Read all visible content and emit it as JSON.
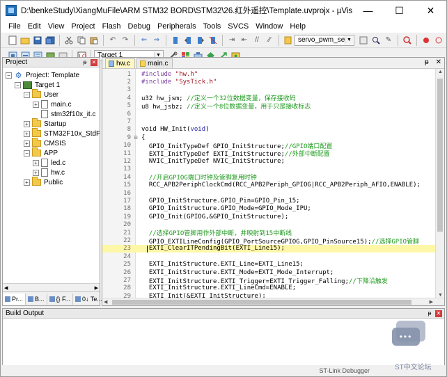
{
  "window": {
    "title": "D:\\benkeStudy\\XiangMuFile\\ARM STM32 BORD\\STM32\\26.红外遥控\\Template.uvprojx - µVision",
    "minimize_glyph": "—",
    "maximize_glyph": "☐",
    "close_glyph": "✕"
  },
  "menu": [
    "File",
    "Edit",
    "View",
    "Project",
    "Flash",
    "Debug",
    "Peripherals",
    "Tools",
    "SVCS",
    "Window",
    "Help"
  ],
  "toolbar1": {
    "target_combo": "servo_pwm_set"
  },
  "toolbar2": {
    "target_combo": "Target 1"
  },
  "project": {
    "title": "Project",
    "pin_glyph": "ᵽ",
    "close_glyph": "✕",
    "tree": [
      {
        "label": "Project: Template",
        "indent": 0,
        "icon": "project",
        "expander": "−"
      },
      {
        "label": "Target 1",
        "indent": 1,
        "icon": "target",
        "expander": "−"
      },
      {
        "label": "User",
        "indent": 2,
        "icon": "folder",
        "expander": "−"
      },
      {
        "label": "main.c",
        "indent": 3,
        "icon": "file",
        "expander": "+"
      },
      {
        "label": "stm32f10x_it.c",
        "indent": 3,
        "icon": "file",
        "expander": ""
      },
      {
        "label": "Startup",
        "indent": 2,
        "icon": "folder",
        "expander": "+"
      },
      {
        "label": "STM32F10x_StdPeriph",
        "indent": 2,
        "icon": "folder",
        "expander": "+"
      },
      {
        "label": "CMSIS",
        "indent": 2,
        "icon": "folder",
        "expander": "+"
      },
      {
        "label": "APP",
        "indent": 2,
        "icon": "folder",
        "expander": "−"
      },
      {
        "label": "led.c",
        "indent": 3,
        "icon": "file",
        "expander": "+"
      },
      {
        "label": "hw.c",
        "indent": 3,
        "icon": "file",
        "expander": "+"
      },
      {
        "label": "Public",
        "indent": 2,
        "icon": "folder",
        "expander": "+"
      }
    ],
    "tabs": [
      "Pr...",
      "B...",
      "{} F...",
      "0↓ Te..."
    ]
  },
  "editor": {
    "tabs": [
      {
        "label": "hw.c",
        "active": true
      },
      {
        "label": "main.c",
        "active": false
      }
    ],
    "pin_glyph": "ᵽ",
    "close_glyph": "✕",
    "current_line": 23,
    "lines": [
      {
        "n": "1",
        "fold": "",
        "parts": [
          {
            "t": "#include ",
            "c": "pp"
          },
          {
            "t": "\"hw.h\"",
            "c": "str"
          }
        ]
      },
      {
        "n": "2",
        "fold": "",
        "parts": [
          {
            "t": "#include ",
            "c": "pp"
          },
          {
            "t": "\"SysTick.h\"",
            "c": "str"
          }
        ]
      },
      {
        "n": "3",
        "fold": "",
        "parts": []
      },
      {
        "n": "4",
        "fold": "",
        "parts": [
          {
            "t": "u32 hw_jsm; ",
            "c": "txt"
          },
          {
            "t": "//定义一个32位数据变量，保存接收码",
            "c": "cmt"
          }
        ]
      },
      {
        "n": "5",
        "fold": "",
        "parts": [
          {
            "t": "u8 hw_jsbz; ",
            "c": "txt"
          },
          {
            "t": "//定义一个8位数据变量，用于只是接收标志",
            "c": "cmt"
          }
        ]
      },
      {
        "n": "6",
        "fold": "",
        "parts": []
      },
      {
        "n": "7",
        "fold": "",
        "parts": []
      },
      {
        "n": "8",
        "fold": "",
        "parts": [
          {
            "t": "void HW_Init(",
            "c": "txt"
          },
          {
            "t": "void",
            "c": "kw"
          },
          {
            "t": ")",
            "c": "txt"
          }
        ]
      },
      {
        "n": "9",
        "fold": "⊟",
        "parts": [
          {
            "t": "{",
            "c": "txt"
          }
        ]
      },
      {
        "n": "10",
        "fold": "",
        "parts": [
          {
            "t": "  GPIO_InitTypeDef GPIO_InitStructure;",
            "c": "txt"
          },
          {
            "t": "//GPIO端口配置",
            "c": "cmt"
          }
        ]
      },
      {
        "n": "11",
        "fold": "",
        "parts": [
          {
            "t": "  EXTI_InitTypeDef EXTI_InitStructure;",
            "c": "txt"
          },
          {
            "t": "//外部中断配置",
            "c": "cmt"
          }
        ]
      },
      {
        "n": "12",
        "fold": "",
        "parts": [
          {
            "t": "  NVIC_InitTypeDef NVIC_InitStructure;",
            "c": "txt"
          }
        ]
      },
      {
        "n": "13",
        "fold": "",
        "parts": []
      },
      {
        "n": "14",
        "fold": "",
        "parts": [
          {
            "t": "  //开启GPIOG端口时钟及管脚复用时钟",
            "c": "cmt"
          }
        ]
      },
      {
        "n": "15",
        "fold": "",
        "parts": [
          {
            "t": "  RCC_APB2PeriphClockCmd(RCC_APB2Periph_GPIOG|RCC_APB2Periph_AFIO,ENABLE);",
            "c": "txt"
          }
        ]
      },
      {
        "n": "16",
        "fold": "",
        "parts": []
      },
      {
        "n": "17",
        "fold": "",
        "parts": [
          {
            "t": "  GPIO_InitStructure.GPIO_Pin=GPIO_Pin_15;",
            "c": "txt"
          }
        ]
      },
      {
        "n": "18",
        "fold": "",
        "parts": [
          {
            "t": "  GPIO_InitStructure.GPIO_Mode=GPIO_Mode_IPU;",
            "c": "txt"
          }
        ]
      },
      {
        "n": "19",
        "fold": "",
        "parts": [
          {
            "t": "  GPIO_Init(GPIOG,&GPIO_InitStructure);",
            "c": "txt"
          }
        ]
      },
      {
        "n": "20",
        "fold": "",
        "parts": []
      },
      {
        "n": "21",
        "fold": "",
        "parts": [
          {
            "t": "  //选择GPIO管脚用作外部中断，并映射到15中断线",
            "c": "cmt"
          }
        ]
      },
      {
        "n": "22",
        "fold": "",
        "parts": [
          {
            "t": "  GPIO_EXTILineConfig(GPIO_PortSourceGPIOG,GPIO_PinSource15);",
            "c": "txt"
          },
          {
            "t": "//选择GPIO管脚",
            "c": "cmt"
          }
        ]
      },
      {
        "n": "23",
        "fold": "",
        "parts": [
          {
            "t": "  EXTI_ClearITPendingBit(EXTI_Line15);",
            "c": "txt"
          }
        ]
      },
      {
        "n": "24",
        "fold": "",
        "parts": []
      },
      {
        "n": "25",
        "fold": "",
        "parts": [
          {
            "t": "  EXTI_InitStructure.EXTI_Line=EXTI_Line15;",
            "c": "txt"
          }
        ]
      },
      {
        "n": "26",
        "fold": "",
        "parts": [
          {
            "t": "  EXTI_InitStructure.EXTI_Mode=EXTI_Mode_Interrupt;",
            "c": "txt"
          }
        ]
      },
      {
        "n": "27",
        "fold": "",
        "parts": [
          {
            "t": "  EXTI_InitStructure.EXTI_Trigger=EXTI_Trigger_Falling;",
            "c": "txt"
          },
          {
            "t": "//下降沿触发",
            "c": "cmt"
          }
        ]
      },
      {
        "n": "28",
        "fold": "",
        "parts": [
          {
            "t": "  EXTI_InitStructure.EXTI_LineCmd=ENABLE;",
            "c": "txt"
          }
        ]
      },
      {
        "n": "29",
        "fold": "",
        "parts": [
          {
            "t": "  EXTI_Init(&EXTI_InitStructure);",
            "c": "txt"
          }
        ]
      }
    ]
  },
  "build": {
    "title": "Build Output",
    "pin_glyph": "ᵽ",
    "close_glyph": "✕"
  },
  "status": {
    "text": "ST-Link Debugger"
  },
  "watermark": {
    "text": "ST中文论坛",
    "bubble_glyph": "•••"
  },
  "colors": {
    "comment": "#1f9a1f",
    "preprocessor": "#7a3fa0",
    "string": "#a0141e",
    "keyword": "#1c1caa",
    "current_line": "#fff7a8"
  }
}
